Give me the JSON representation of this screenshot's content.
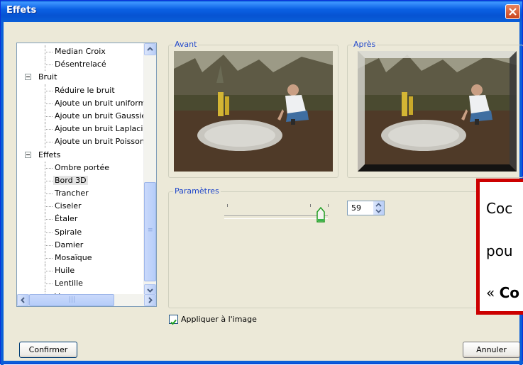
{
  "window": {
    "title": "Effets"
  },
  "tree": {
    "items": [
      {
        "label": "Median Croix",
        "level": 2
      },
      {
        "label": "Désentrelacé",
        "level": 2
      },
      {
        "label": "Bruit",
        "level": 1,
        "expanded": true
      },
      {
        "label": "Réduire le bruit",
        "level": 2
      },
      {
        "label": "Ajoute un bruit uniforme",
        "level": 2
      },
      {
        "label": "Ajoute un bruit Gaussien",
        "level": 2
      },
      {
        "label": "Ajoute un bruit Laplacien",
        "level": 2
      },
      {
        "label": "Ajoute un bruit Poisson",
        "level": 2
      },
      {
        "label": "Effets",
        "level": 1,
        "expanded": true
      },
      {
        "label": "Ombre portée",
        "level": 2
      },
      {
        "label": "Bord 3D",
        "level": 2,
        "selected": true
      },
      {
        "label": "Trancher",
        "level": 2
      },
      {
        "label": "Ciseler",
        "level": 2
      },
      {
        "label": "Étaler",
        "level": 2
      },
      {
        "label": "Spirale",
        "level": 2
      },
      {
        "label": "Damier",
        "level": 2
      },
      {
        "label": "Mosaïque",
        "level": 2
      },
      {
        "label": "Huile",
        "level": 2
      },
      {
        "label": "Lentille",
        "level": 2
      },
      {
        "label": "Vague",
        "level": 2
      }
    ]
  },
  "preview": {
    "before_label": "Avant",
    "after_label": "Après"
  },
  "params": {
    "label": "Paramètres",
    "value": "59"
  },
  "apply": {
    "label": "Appliquer à l'image",
    "checked": true
  },
  "buttons": {
    "confirm": "Confirmer",
    "cancel": "Annuler"
  },
  "callout": {
    "line1": "Coc",
    "line2": "pou",
    "line3_prefix": "« ",
    "line3_bold": "Co"
  },
  "colors": {
    "title_bar": "#0a5fd8",
    "callout_border": "#cc0000",
    "group_label": "#1f46c9"
  }
}
